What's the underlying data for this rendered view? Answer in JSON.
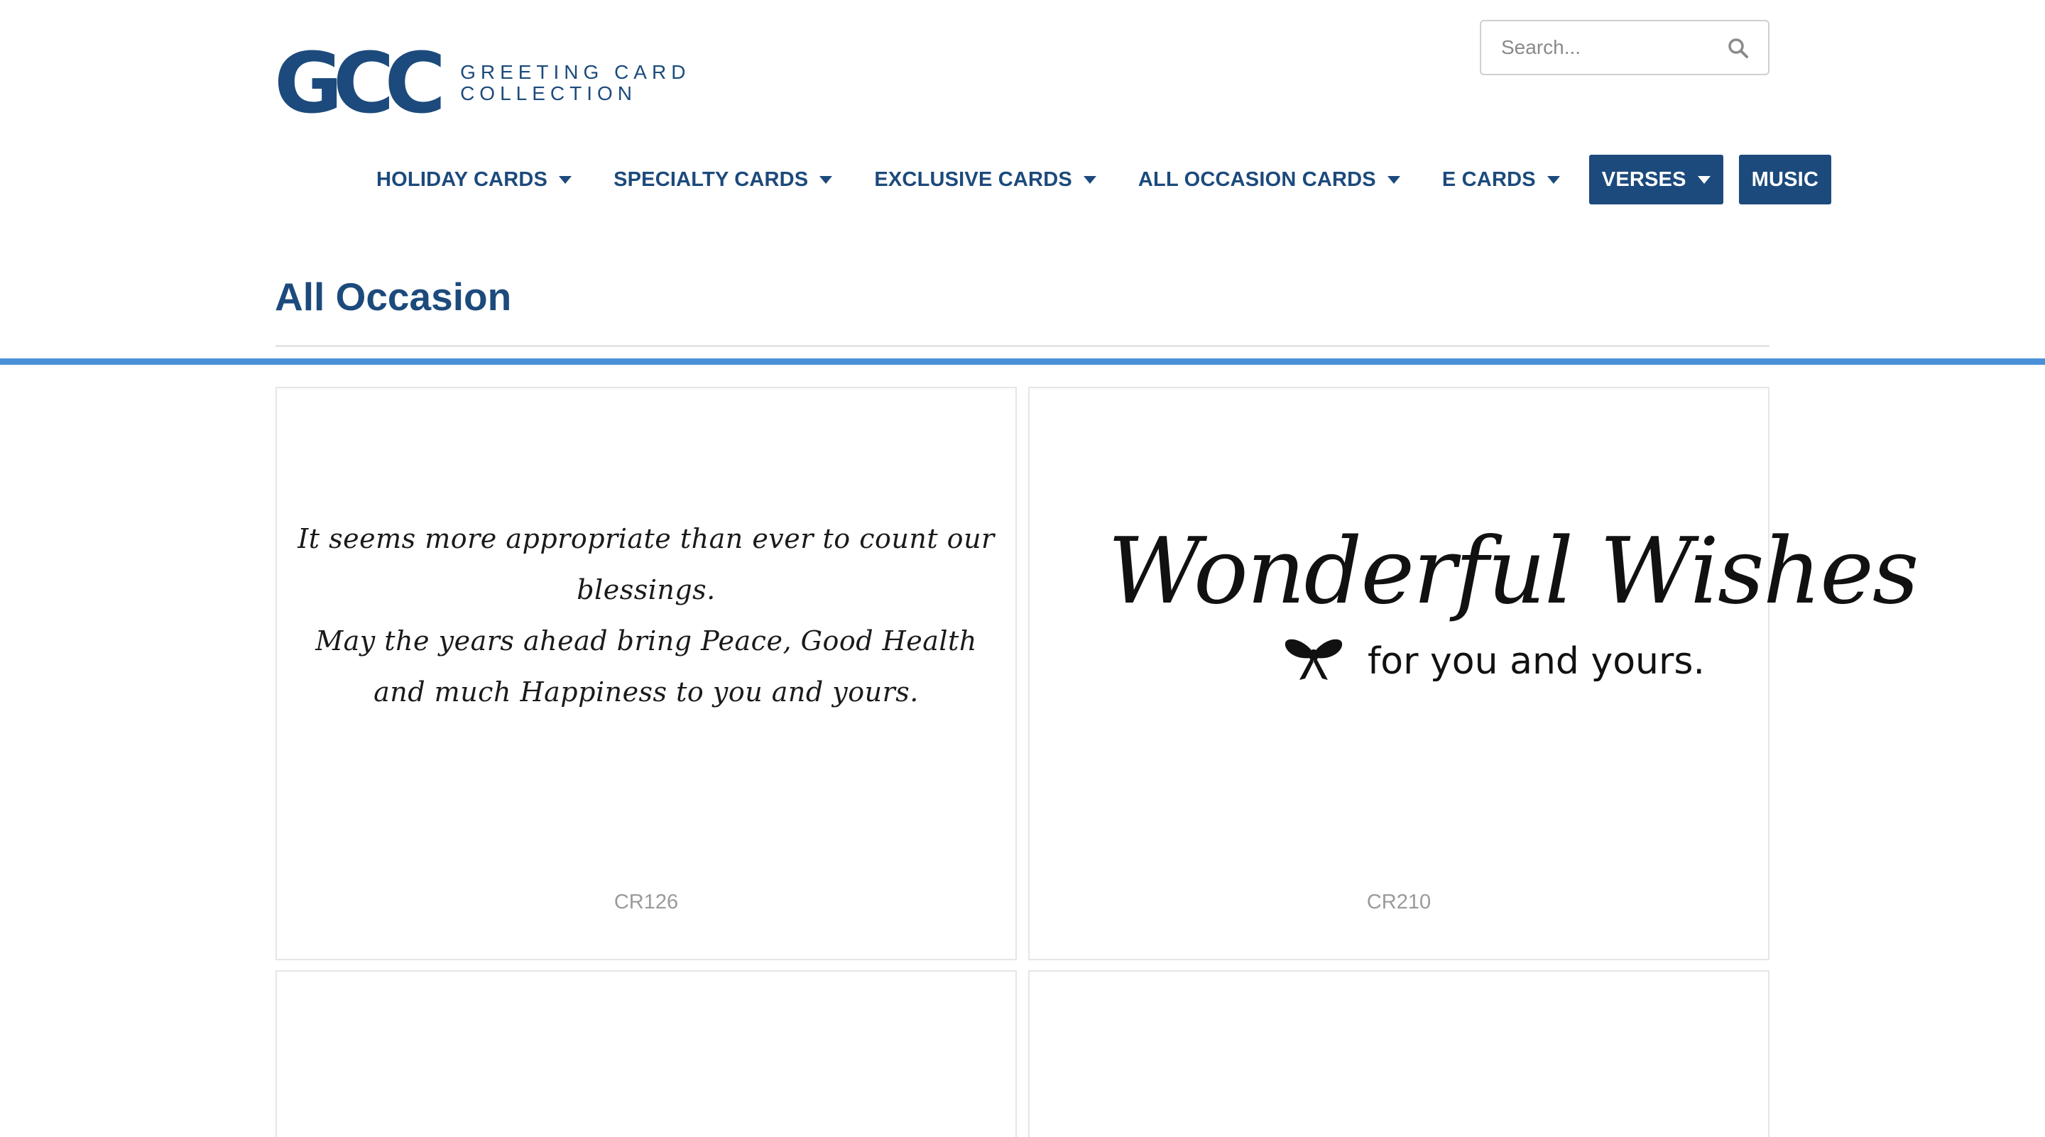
{
  "header": {
    "logo_mark": "GCC",
    "logo_line1": "GREETING CARD",
    "logo_line2": "COLLECTION",
    "search_placeholder": "Search...",
    "search_icon": "search-icon"
  },
  "nav": {
    "items": [
      {
        "label": "HOLIDAY CARDS",
        "dropdown": true
      },
      {
        "label": "SPECIALTY CARDS",
        "dropdown": true
      },
      {
        "label": "EXCLUSIVE CARDS",
        "dropdown": true
      },
      {
        "label": "ALL OCCASION CARDS",
        "dropdown": true
      },
      {
        "label": "E CARDS",
        "dropdown": true
      },
      {
        "label": "VERSES",
        "dropdown": true,
        "active": true
      },
      {
        "label": "MUSIC",
        "dropdown": false,
        "active": true
      }
    ]
  },
  "main": {
    "title": "All Occasion",
    "cards": [
      {
        "code": "CR126",
        "verse_lines": [
          "It seems more appropriate than ever to count our blessings.",
          "May the years ahead bring Peace, Good Health",
          "and much Happiness to you and yours."
        ]
      },
      {
        "code": "CR210",
        "script_text": "Wonderful Wishes",
        "sub_text": "for you and yours."
      }
    ]
  },
  "colors": {
    "brand_navy": "#1c4a7c",
    "nav_underline": "#4a90d9",
    "card_border": "#e6e6e6",
    "code_text": "#9a9a9a"
  }
}
